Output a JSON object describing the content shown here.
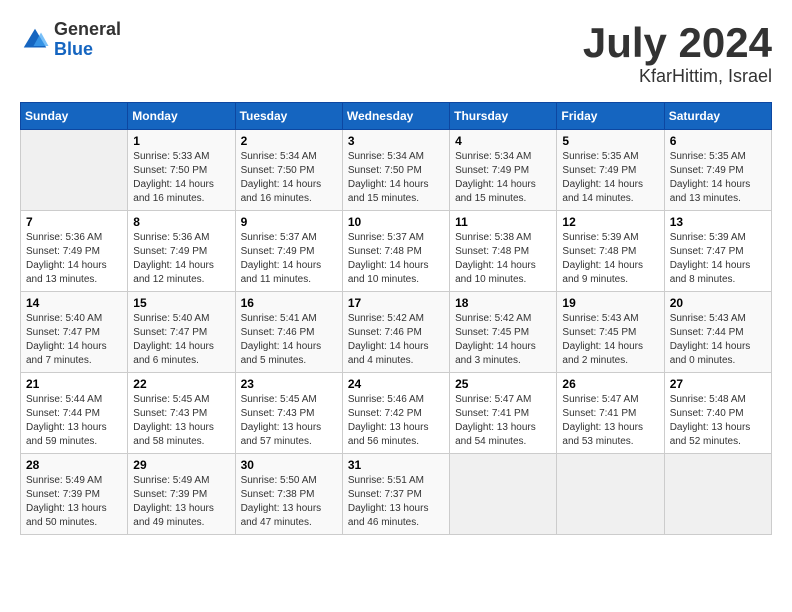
{
  "header": {
    "logo": {
      "general": "General",
      "blue": "Blue"
    },
    "title": "July 2024",
    "location": "KfarHittim, Israel"
  },
  "calendar": {
    "days_of_week": [
      "Sunday",
      "Monday",
      "Tuesday",
      "Wednesday",
      "Thursday",
      "Friday",
      "Saturday"
    ],
    "weeks": [
      [
        {
          "day": "",
          "info": ""
        },
        {
          "day": "1",
          "info": "Sunrise: 5:33 AM\nSunset: 7:50 PM\nDaylight: 14 hours\nand 16 minutes."
        },
        {
          "day": "2",
          "info": "Sunrise: 5:34 AM\nSunset: 7:50 PM\nDaylight: 14 hours\nand 16 minutes."
        },
        {
          "day": "3",
          "info": "Sunrise: 5:34 AM\nSunset: 7:50 PM\nDaylight: 14 hours\nand 15 minutes."
        },
        {
          "day": "4",
          "info": "Sunrise: 5:34 AM\nSunset: 7:49 PM\nDaylight: 14 hours\nand 15 minutes."
        },
        {
          "day": "5",
          "info": "Sunrise: 5:35 AM\nSunset: 7:49 PM\nDaylight: 14 hours\nand 14 minutes."
        },
        {
          "day": "6",
          "info": "Sunrise: 5:35 AM\nSunset: 7:49 PM\nDaylight: 14 hours\nand 13 minutes."
        }
      ],
      [
        {
          "day": "7",
          "info": "Sunrise: 5:36 AM\nSunset: 7:49 PM\nDaylight: 14 hours\nand 13 minutes."
        },
        {
          "day": "8",
          "info": "Sunrise: 5:36 AM\nSunset: 7:49 PM\nDaylight: 14 hours\nand 12 minutes."
        },
        {
          "day": "9",
          "info": "Sunrise: 5:37 AM\nSunset: 7:49 PM\nDaylight: 14 hours\nand 11 minutes."
        },
        {
          "day": "10",
          "info": "Sunrise: 5:37 AM\nSunset: 7:48 PM\nDaylight: 14 hours\nand 10 minutes."
        },
        {
          "day": "11",
          "info": "Sunrise: 5:38 AM\nSunset: 7:48 PM\nDaylight: 14 hours\nand 10 minutes."
        },
        {
          "day": "12",
          "info": "Sunrise: 5:39 AM\nSunset: 7:48 PM\nDaylight: 14 hours\nand 9 minutes."
        },
        {
          "day": "13",
          "info": "Sunrise: 5:39 AM\nSunset: 7:47 PM\nDaylight: 14 hours\nand 8 minutes."
        }
      ],
      [
        {
          "day": "14",
          "info": "Sunrise: 5:40 AM\nSunset: 7:47 PM\nDaylight: 14 hours\nand 7 minutes."
        },
        {
          "day": "15",
          "info": "Sunrise: 5:40 AM\nSunset: 7:47 PM\nDaylight: 14 hours\nand 6 minutes."
        },
        {
          "day": "16",
          "info": "Sunrise: 5:41 AM\nSunset: 7:46 PM\nDaylight: 14 hours\nand 5 minutes."
        },
        {
          "day": "17",
          "info": "Sunrise: 5:42 AM\nSunset: 7:46 PM\nDaylight: 14 hours\nand 4 minutes."
        },
        {
          "day": "18",
          "info": "Sunrise: 5:42 AM\nSunset: 7:45 PM\nDaylight: 14 hours\nand 3 minutes."
        },
        {
          "day": "19",
          "info": "Sunrise: 5:43 AM\nSunset: 7:45 PM\nDaylight: 14 hours\nand 2 minutes."
        },
        {
          "day": "20",
          "info": "Sunrise: 5:43 AM\nSunset: 7:44 PM\nDaylight: 14 hours\nand 0 minutes."
        }
      ],
      [
        {
          "day": "21",
          "info": "Sunrise: 5:44 AM\nSunset: 7:44 PM\nDaylight: 13 hours\nand 59 minutes."
        },
        {
          "day": "22",
          "info": "Sunrise: 5:45 AM\nSunset: 7:43 PM\nDaylight: 13 hours\nand 58 minutes."
        },
        {
          "day": "23",
          "info": "Sunrise: 5:45 AM\nSunset: 7:43 PM\nDaylight: 13 hours\nand 57 minutes."
        },
        {
          "day": "24",
          "info": "Sunrise: 5:46 AM\nSunset: 7:42 PM\nDaylight: 13 hours\nand 56 minutes."
        },
        {
          "day": "25",
          "info": "Sunrise: 5:47 AM\nSunset: 7:41 PM\nDaylight: 13 hours\nand 54 minutes."
        },
        {
          "day": "26",
          "info": "Sunrise: 5:47 AM\nSunset: 7:41 PM\nDaylight: 13 hours\nand 53 minutes."
        },
        {
          "day": "27",
          "info": "Sunrise: 5:48 AM\nSunset: 7:40 PM\nDaylight: 13 hours\nand 52 minutes."
        }
      ],
      [
        {
          "day": "28",
          "info": "Sunrise: 5:49 AM\nSunset: 7:39 PM\nDaylight: 13 hours\nand 50 minutes."
        },
        {
          "day": "29",
          "info": "Sunrise: 5:49 AM\nSunset: 7:39 PM\nDaylight: 13 hours\nand 49 minutes."
        },
        {
          "day": "30",
          "info": "Sunrise: 5:50 AM\nSunset: 7:38 PM\nDaylight: 13 hours\nand 47 minutes."
        },
        {
          "day": "31",
          "info": "Sunrise: 5:51 AM\nSunset: 7:37 PM\nDaylight: 13 hours\nand 46 minutes."
        },
        {
          "day": "",
          "info": ""
        },
        {
          "day": "",
          "info": ""
        },
        {
          "day": "",
          "info": ""
        }
      ]
    ]
  }
}
